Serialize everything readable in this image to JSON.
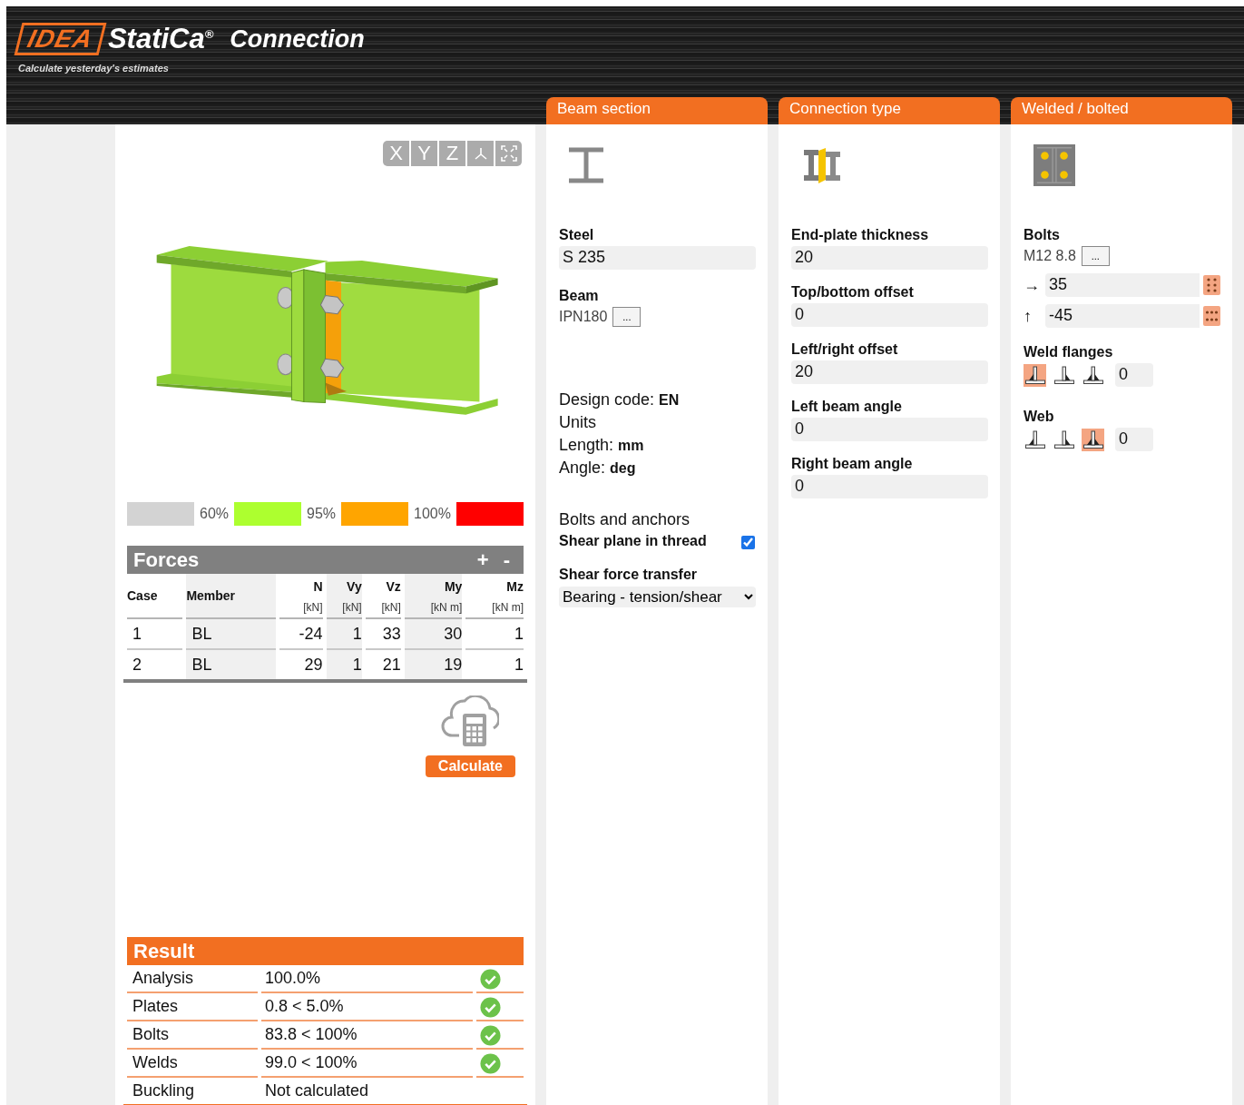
{
  "header": {
    "logo": "IDEA",
    "product": "StatiCa",
    "product_mark": "®",
    "module": "Connection",
    "tagline": "Calculate yesterday's estimates"
  },
  "view_buttons": [
    "X",
    "Y",
    "Z"
  ],
  "legend": [
    {
      "color": "#d3d3d3",
      "label": "60%"
    },
    {
      "color": "#adff2f",
      "label": "95%"
    },
    {
      "color": "#ffa500",
      "label": "100%"
    },
    {
      "color": "#ff0000"
    }
  ],
  "forces": {
    "title": "Forces",
    "add": "+",
    "remove": "-",
    "columns": [
      {
        "name": "Case"
      },
      {
        "name": "Member"
      },
      {
        "name": "N",
        "unit": "[kN]"
      },
      {
        "name": "Vy",
        "unit": "[kN]"
      },
      {
        "name": "Vz",
        "unit": "[kN]"
      },
      {
        "name": "My",
        "unit": "[kN m]"
      },
      {
        "name": "Mz",
        "unit": "[kN m]"
      }
    ],
    "rows": [
      [
        "1",
        "BL",
        "-24",
        "1",
        "33",
        "30",
        "1"
      ],
      [
        "2",
        "BL",
        "29",
        "1",
        "21",
        "19",
        "1"
      ]
    ]
  },
  "calculate": "Calculate",
  "result": {
    "title": "Result",
    "rows": [
      {
        "label": "Analysis",
        "value": "100.0%",
        "ok": true
      },
      {
        "label": "Plates",
        "value": "0.8 < 5.0%",
        "ok": true
      },
      {
        "label": "Bolts",
        "value": "83.8 < 100%",
        "ok": true
      },
      {
        "label": "Welds",
        "value": "99.0 < 100%",
        "ok": true
      },
      {
        "label": "Buckling",
        "value": "Not calculated",
        "ok": false
      }
    ]
  },
  "beam_section": {
    "tab": "Beam section",
    "steel_label": "Steel",
    "steel": "S 235",
    "beam_label": "Beam",
    "beam": "IPN180",
    "browse": "...",
    "design_code_label": "Design code:",
    "design_code": "EN",
    "units": "Units",
    "length_label": "Length:",
    "length": "mm",
    "angle_label": "Angle:",
    "angle": "deg",
    "bolts_heading": "Bolts and anchors",
    "shear_plane_label": "Shear plane in thread",
    "shear_plane_checked": true,
    "shear_transfer_label": "Shear force transfer",
    "shear_transfer": "Bearing - tension/shear"
  },
  "connection_type": {
    "tab": "Connection type",
    "fields": [
      {
        "label": "End-plate thickness",
        "value": "20"
      },
      {
        "label": "Top/bottom offset",
        "value": "0"
      },
      {
        "label": "Left/right offset",
        "value": "20"
      },
      {
        "label": "Left beam angle",
        "value": "0"
      },
      {
        "label": "Right beam angle",
        "value": "0"
      }
    ]
  },
  "welded_bolted": {
    "tab": "Welded / bolted",
    "bolts_label": "Bolts",
    "bolts": "M12 8.8",
    "browse": "...",
    "offsets": [
      {
        "arrow": "→",
        "value": "35"
      },
      {
        "arrow": "↑",
        "value": "-45"
      }
    ],
    "weld_groups": [
      {
        "label": "Weld flanges",
        "value": "0",
        "options": [
          {
            "kind": "left",
            "selected": true
          },
          {
            "kind": "right",
            "selected": false
          },
          {
            "kind": "both",
            "selected": false
          }
        ]
      },
      {
        "label": "Web",
        "value": "0",
        "options": [
          {
            "kind": "left",
            "selected": false
          },
          {
            "kind": "right",
            "selected": false
          },
          {
            "kind": "both",
            "selected": true
          }
        ]
      }
    ]
  }
}
